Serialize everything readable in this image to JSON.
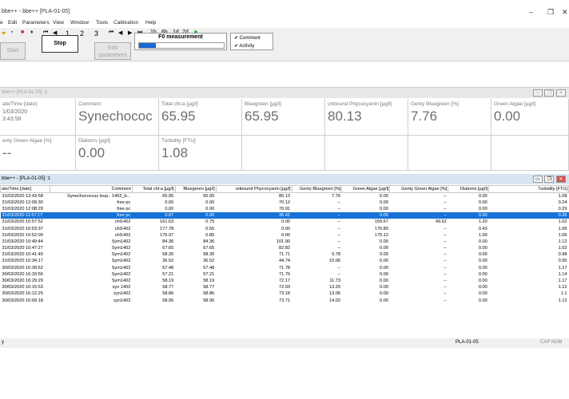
{
  "window": {
    "title": "bbe++ - bbe++ [PLA-01-05]",
    "minimize": "–",
    "maximize": "❐",
    "close": "✕"
  },
  "menu": [
    "e",
    "Edit",
    "Parameters",
    "View",
    "Window",
    "Tools",
    "Calibration",
    "Help"
  ],
  "toolbar": {
    "nav": [
      "⏮",
      "◀",
      "1",
      "2",
      "3",
      "⏮",
      "◀",
      "▶",
      "⏭",
      "1h",
      "6h",
      "1d",
      "7d"
    ],
    "start_label": "Start",
    "stop_label": "Stop",
    "edit_label_1": "Edit",
    "edit_label_2": "parameters",
    "f0_label": "F0 measurement",
    "f0_progress": 0.2,
    "check_comment": "Comment",
    "check_activity": "Activity"
  },
  "panel1": {
    "title": "bbe++ [PLA-01-05] :2",
    "cells": [
      {
        "label": "ate/Time [date]",
        "lines": [
          "1/03/2020",
          "3:43:58"
        ]
      },
      {
        "label": "Comment",
        "value": "Synechococ"
      },
      {
        "label": "Total chl-a [µg/l]",
        "value": "65.95"
      },
      {
        "label": "Bluegreen [µg/l]",
        "value": "65.95"
      },
      {
        "label": "unbound Phycocyanin [µg/l]",
        "value": "80.13"
      },
      {
        "label": "Genty Bluegreen [%]",
        "value": "7.76"
      },
      {
        "label": "Green Algae [µg/l]",
        "value": "0.00"
      },
      {
        "label": "enty Green Algae [%]",
        "value": "--"
      },
      {
        "label": "Diatoms [µg/l]",
        "value": "0.00"
      },
      {
        "label": "Turbidity [FTU]",
        "value": "1.08"
      }
    ]
  },
  "panel2": {
    "title": "bbe++ - [PLA-01-05] :1",
    "columns": [
      "ate/Time [date]",
      "Comment",
      "Total chl-a [µg/l]",
      "Bluegreen [µg/l]",
      "unbound Phycocyanin [µg/l]",
      "Genty Bluegreen [%]",
      "Green Algae [µg/l]",
      "Genty Green Algae [%]",
      "Diatoms [µg/l]",
      "Turbidity [FTU]"
    ],
    "rows": [
      [
        "31/03/2020 13:43:58",
        "Synechococcus leop.. 1402_b...",
        "65.95",
        "65.95",
        "80.13",
        "7.76",
        "0.00",
        "--",
        "0.00",
        "1.08"
      ],
      [
        "31/03/2020 12:09:30",
        "free pc",
        "0.00",
        "0.00",
        "70.12",
        "--",
        "0.00",
        "--",
        "0.00",
        "0.24"
      ],
      [
        "31/03/2020 12:08:29",
        "free pc",
        "0.00",
        "0.00",
        "70.91",
        "--",
        "0.00",
        "--",
        "0.00",
        "0.29"
      ],
      [
        "31/03/2020 11:57:17",
        "free pc",
        "0.07",
        "0.00",
        "36.41",
        "--",
        "0.00",
        "--",
        "0.00",
        "0.26"
      ],
      [
        "31/03/2020 10:57:52",
        "chl1402",
        "161.63",
        "0.75",
        "0.00",
        "--",
        "159.67",
        "49.62",
        "1.20",
        "1.02"
      ],
      [
        "31/03/2020 10:53:37",
        "chl1402",
        "177.78",
        "0.55",
        "0.00",
        "--",
        "176.80",
        "--",
        "0.43",
        "1.06"
      ],
      [
        "31/03/2020 10:52:00",
        "chl1402",
        "176.97",
        "0.85",
        "0.00",
        "--",
        "175.12",
        "--",
        "1.00",
        "1.06"
      ],
      [
        "31/03/2020 10:49:44",
        "Sym1402",
        "84.36",
        "84.36",
        "101.90",
        "--",
        "0.00",
        "--",
        "0.00",
        "1.12"
      ],
      [
        "31/03/2020 10:47:27",
        "Sym1402",
        "67.65",
        "67.65",
        "82.82",
        "--",
        "0.00",
        "--",
        "0.00",
        "1.02"
      ],
      [
        "31/03/2020 10:41:40",
        "Sym1402",
        "58.30",
        "58.30",
        "71.71",
        "9.78",
        "0.00",
        "--",
        "0.00",
        "0.98"
      ],
      [
        "31/03/2020 10:34:17",
        "Sym1402",
        "36.52",
        "36.52",
        "44.74",
        "10.06",
        "0.00",
        "--",
        "0.00",
        "0.95"
      ],
      [
        "30/03/2020 16:39:52",
        "Sym1402",
        "57.48",
        "57.48",
        "71.78",
        "--",
        "0.00",
        "--",
        "0.00",
        "1.17"
      ],
      [
        "30/03/2020 16:33:56",
        "Sym1402",
        "57.21",
        "57.21",
        "71.70",
        "--",
        "0.00",
        "--",
        "0.00",
        "1.14"
      ],
      [
        "30/03/2020 16:29:29",
        "Sym1402",
        "58.19",
        "58.19",
        "72.17",
        "11.73",
        "0.00",
        "--",
        "0.00",
        "1.17"
      ],
      [
        "30/03/2020 16:15:53",
        "syn 1402",
        "58.77",
        "58.77",
        "72.93",
        "13.20",
        "0.00",
        "--",
        "0.00",
        "1.12"
      ],
      [
        "30/03/2020 16:12:25",
        "syn1402",
        "58.86",
        "58.86",
        "73.18",
        "13.06",
        "0.00",
        "--",
        "0.00",
        "1.1"
      ],
      [
        "30/03/2020 16:09:18",
        "syn1402",
        "58.95",
        "58.95",
        "73.71",
        "14.02",
        "0.00",
        "--",
        "0.00",
        "1.12"
      ]
    ],
    "selected_row": 3
  },
  "status": {
    "left": "y",
    "center": "PLA-01-05",
    "right": "CAP  NUM"
  }
}
